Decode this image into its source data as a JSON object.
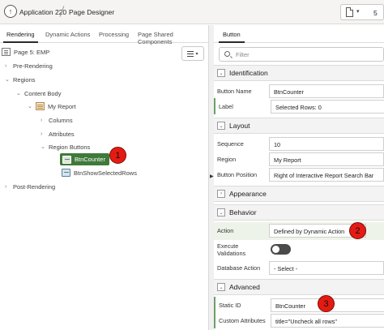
{
  "header": {
    "app_name": "Application 220",
    "page_name": "Page Designer",
    "page_number": "5",
    "up_icon": "arrow-up-icon",
    "page_icon": "document-icon"
  },
  "left_tabs": [
    "Rendering",
    "Dynamic Actions",
    "Processing",
    "Page Shared Components"
  ],
  "tree": {
    "page": "Page 5: EMP",
    "pre_rendering": "Pre-Rendering",
    "regions": "Regions",
    "content_body": "Content Body",
    "my_report": "My Report",
    "columns": "Columns",
    "attributes": "Attributes",
    "region_buttons": "Region Buttons",
    "btn_counter": "BtnCounter",
    "btn_show_selected": "BtnShowSelectedRows",
    "post_rendering": "Post-Rendering"
  },
  "right_tab": "Button",
  "filter_placeholder": "Filter",
  "groups": {
    "identification": "Identification",
    "layout": "Layout",
    "appearance": "Appearance",
    "behavior": "Behavior",
    "advanced": "Advanced"
  },
  "properties": {
    "button_name_label": "Button Name",
    "button_name_value": "BtnCounter",
    "label_label": "Label",
    "label_value": "Selected Rows: 0",
    "sequence_label": "Sequence",
    "sequence_value": "10",
    "region_label": "Region",
    "region_value": "My Report",
    "button_position_label": "Button Position",
    "button_position_value": "Right of Interactive Report Search Bar",
    "action_label": "Action",
    "action_value": "Defined by Dynamic Action",
    "execute_validations_label_1": "Execute",
    "execute_validations_label_2": "Validations",
    "database_action_label": "Database Action",
    "database_action_value": "- Select -",
    "static_id_label": "Static ID",
    "static_id_value": "BtnCounter",
    "custom_attributes_label": "Custom Attributes",
    "custom_attributes_value": "title=\"Uncheck all rows\""
  },
  "callouts": [
    "1",
    "2",
    "3"
  ],
  "colors": {
    "selected_node": "#3f7a3a",
    "callout": "#e51b13"
  }
}
